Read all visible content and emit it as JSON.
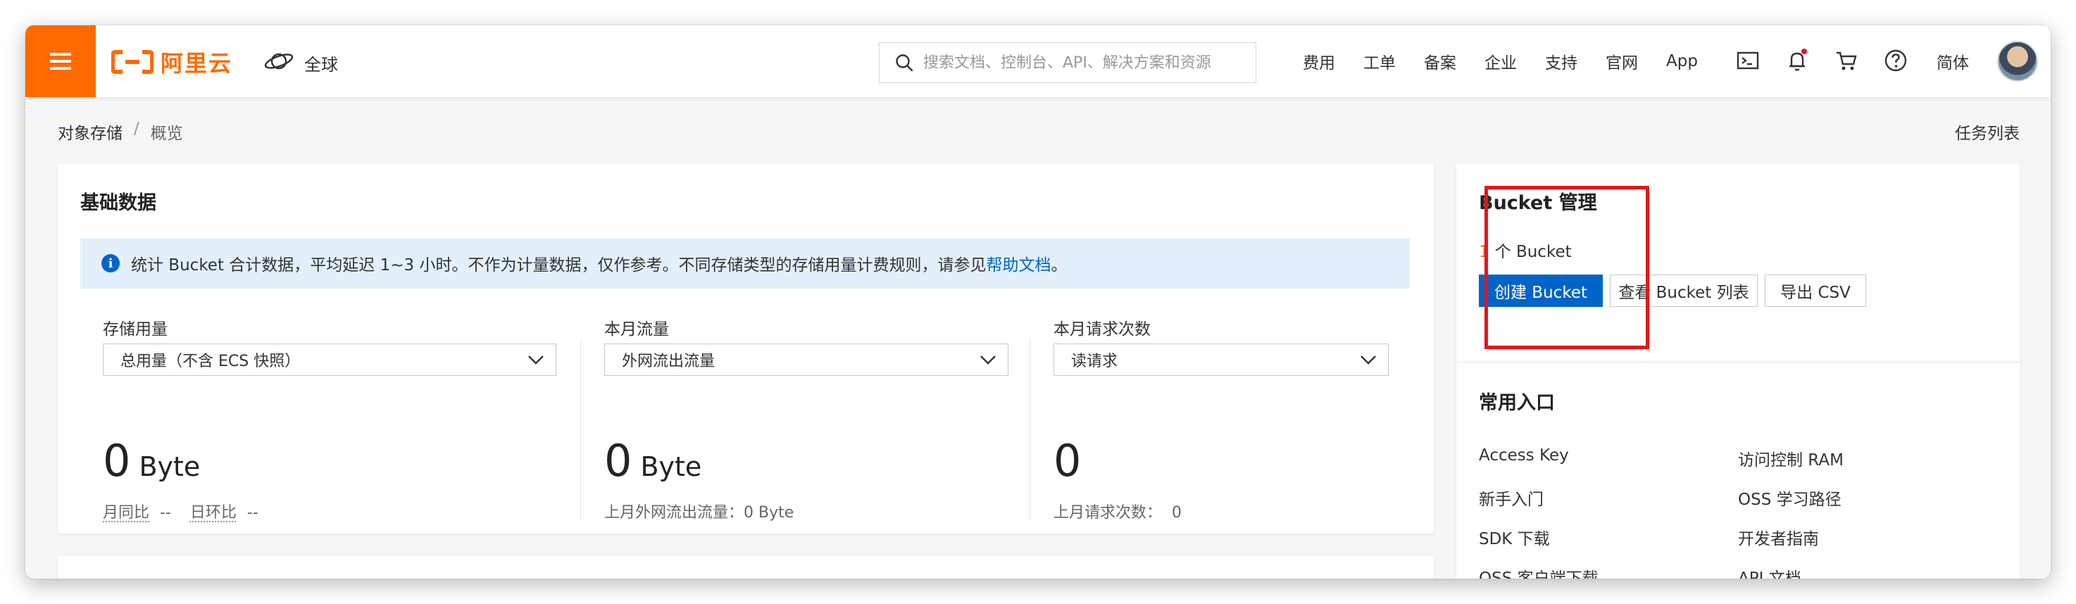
{
  "header": {
    "logo_text": "阿里云",
    "region_label": "全球",
    "search_placeholder": "搜索文档、控制台、API、解决方案和资源",
    "nav_links": [
      "费用",
      "工单",
      "备案",
      "企业",
      "支持",
      "官网",
      "App"
    ],
    "language": "简体",
    "accent_color": "#ff6a00"
  },
  "breadcrumb": {
    "root": "对象存储",
    "separator": "/",
    "current": "概览"
  },
  "task_list": "任务列表",
  "basic_data": {
    "title": "基础数据",
    "notice_text": "统计 Bucket 合计数据，平均延迟 1~3 小时。不作为计量数据，仅作参考。不同存储类型的存储用量计费规则，请参见",
    "notice_link": "帮助文档",
    "notice_end": "。",
    "metrics": [
      {
        "label": "存储用量",
        "select_value": "总用量（不含 ECS 快照）",
        "value": "0",
        "unit": "Byte",
        "sub_mom": "月同比",
        "sub_mom_val": "--",
        "sub_yoy": "日环比",
        "sub_yoy_val": "--"
      },
      {
        "label": "本月流量",
        "select_value": "外网流出流量",
        "value": "0",
        "unit": "Byte",
        "sub_text": "上月外网流出流量：0 Byte"
      },
      {
        "label": "本月请求次数",
        "select_value": "读请求",
        "value": "0",
        "sub_text": "上月请求次数：  0"
      }
    ]
  },
  "bucket_mgmt": {
    "title": "Bucket 管理",
    "count": "1",
    "count_suffix": "个 Bucket",
    "create_button": "创建 Bucket",
    "list_button": "查看 Bucket 列表",
    "export_button": "导出 CSV",
    "primary_color": "#0064c8",
    "highlight_color": "#e8141a"
  },
  "common_entry": {
    "title": "常用入口",
    "links": [
      "Access Key",
      "访问控制 RAM",
      "新手入门",
      "OSS 学习路径",
      "SDK 下载",
      "开发者指南",
      "OSS 客户端下载",
      "API 文档"
    ]
  }
}
